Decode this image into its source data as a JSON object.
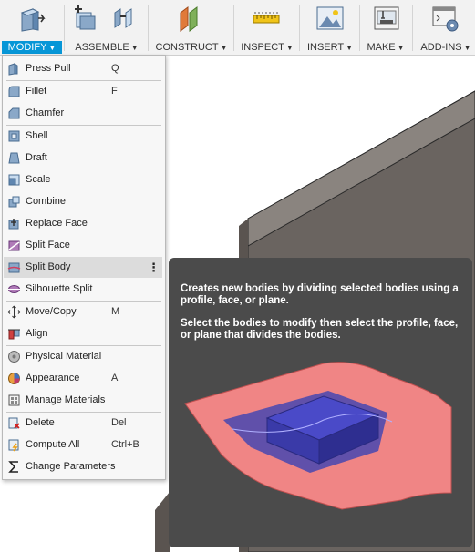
{
  "toolbar": {
    "groups": [
      {
        "label": "MODIFY",
        "icon": "press-pull-icon",
        "active": true
      },
      {
        "label": "ASSEMBLE",
        "icon": "joint-icon",
        "active": false
      },
      {
        "label": "CONSTRUCT",
        "icon": "offset-plane-icon",
        "active": false
      },
      {
        "label": "INSPECT",
        "icon": "measure-ruler-icon",
        "active": false
      },
      {
        "label": "INSERT",
        "icon": "insert-image-icon",
        "active": false
      },
      {
        "label": "MAKE",
        "icon": "3d-print-icon",
        "active": false
      },
      {
        "label": "ADD-INS",
        "icon": "scripts-addins-icon",
        "active": false
      }
    ],
    "accent_color": "#0696d7"
  },
  "menu": {
    "items": [
      {
        "label": "Press Pull",
        "shortcut": "Q",
        "icon": "press-pull-icon"
      },
      {
        "label": "Fillet",
        "shortcut": "F",
        "icon": "fillet-icon"
      },
      {
        "label": "Chamfer",
        "shortcut": "",
        "icon": "chamfer-icon"
      },
      {
        "label": "Shell",
        "shortcut": "",
        "icon": "shell-icon"
      },
      {
        "label": "Draft",
        "shortcut": "",
        "icon": "draft-icon"
      },
      {
        "label": "Scale",
        "shortcut": "",
        "icon": "scale-icon"
      },
      {
        "label": "Combine",
        "shortcut": "",
        "icon": "combine-icon"
      },
      {
        "label": "Replace Face",
        "shortcut": "",
        "icon": "replace-face-icon"
      },
      {
        "label": "Split Face",
        "shortcut": "",
        "icon": "split-face-icon"
      },
      {
        "label": "Split Body",
        "shortcut": "",
        "icon": "split-body-icon",
        "hovered": true,
        "more": "⋮"
      },
      {
        "label": "Silhouette Split",
        "shortcut": "",
        "icon": "silhouette-split-icon"
      },
      {
        "label": "Move/Copy",
        "shortcut": "M",
        "icon": "move-copy-icon"
      },
      {
        "label": "Align",
        "shortcut": "",
        "icon": "align-icon"
      },
      {
        "label": "Physical Material",
        "shortcut": "",
        "icon": "physical-material-icon"
      },
      {
        "label": "Appearance",
        "shortcut": "A",
        "icon": "appearance-icon"
      },
      {
        "label": "Manage Materials",
        "shortcut": "",
        "icon": "manage-materials-icon"
      },
      {
        "label": "Delete",
        "shortcut": "Del",
        "icon": "delete-icon"
      },
      {
        "label": "Compute All",
        "shortcut": "Ctrl+B",
        "icon": "compute-all-icon"
      },
      {
        "label": "Change Parameters",
        "shortcut": "",
        "icon": "sigma-icon"
      }
    ]
  },
  "tooltip": {
    "line1": "Creates new bodies by dividing selected bodies using a profile, face, or plane.",
    "line2": "Select the bodies to modify then select the profile, face, or plane that divides the bodies."
  }
}
